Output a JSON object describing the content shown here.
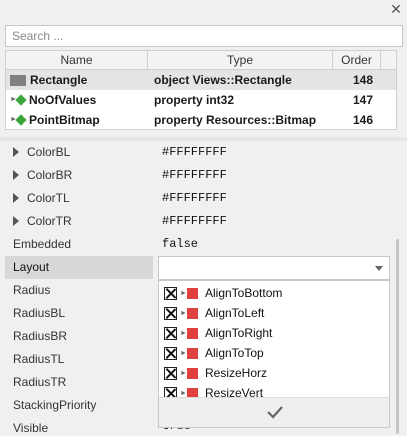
{
  "search": {
    "placeholder": "Search ..."
  },
  "members": {
    "headers": {
      "name": "Name",
      "type": "Type",
      "order": "Order"
    },
    "rows": [
      {
        "name": "Rectangle",
        "type": "object Views::Rectangle",
        "order": "148",
        "icon": "rectangle-icon"
      },
      {
        "name": "NoOfValues",
        "type": "property int32",
        "order": "147",
        "icon": "property-diamond-icon"
      },
      {
        "name": "PointBitmap",
        "type": "property Resources::Bitmap",
        "order": "146",
        "icon": "property-diamond-icon"
      }
    ]
  },
  "properties": [
    {
      "name": "ColorBL",
      "value": "#FFFFFFFF",
      "expandable": true
    },
    {
      "name": "ColorBR",
      "value": "#FFFFFFFF",
      "expandable": true
    },
    {
      "name": "ColorTL",
      "value": "#FFFFFFFF",
      "expandable": true
    },
    {
      "name": "ColorTR",
      "value": "#FFFFFFFF",
      "expandable": true
    },
    {
      "name": "Embedded",
      "value": "false",
      "expandable": false
    },
    {
      "name": "Layout",
      "value": "",
      "expandable": false
    },
    {
      "name": "Radius",
      "value": "",
      "expandable": false
    },
    {
      "name": "RadiusBL",
      "value": "",
      "expandable": false
    },
    {
      "name": "RadiusBR",
      "value": "",
      "expandable": false
    },
    {
      "name": "RadiusTL",
      "value": "",
      "expandable": false
    },
    {
      "name": "RadiusTR",
      "value": "",
      "expandable": false
    },
    {
      "name": "StackingPriority",
      "value": "",
      "expandable": false
    },
    {
      "name": "Visible",
      "value": "true",
      "expandable": false
    }
  ],
  "layout_options": [
    {
      "label": "AlignToBottom",
      "checked": true
    },
    {
      "label": "AlignToLeft",
      "checked": true
    },
    {
      "label": "AlignToRight",
      "checked": true
    },
    {
      "label": "AlignToTop",
      "checked": true
    },
    {
      "label": "ResizeHorz",
      "checked": true
    },
    {
      "label": "ResizeVert",
      "checked": true
    }
  ],
  "colors": {
    "diamond": "#3ba53b",
    "flag": "#e04040",
    "selection": "#e4e4e4"
  }
}
